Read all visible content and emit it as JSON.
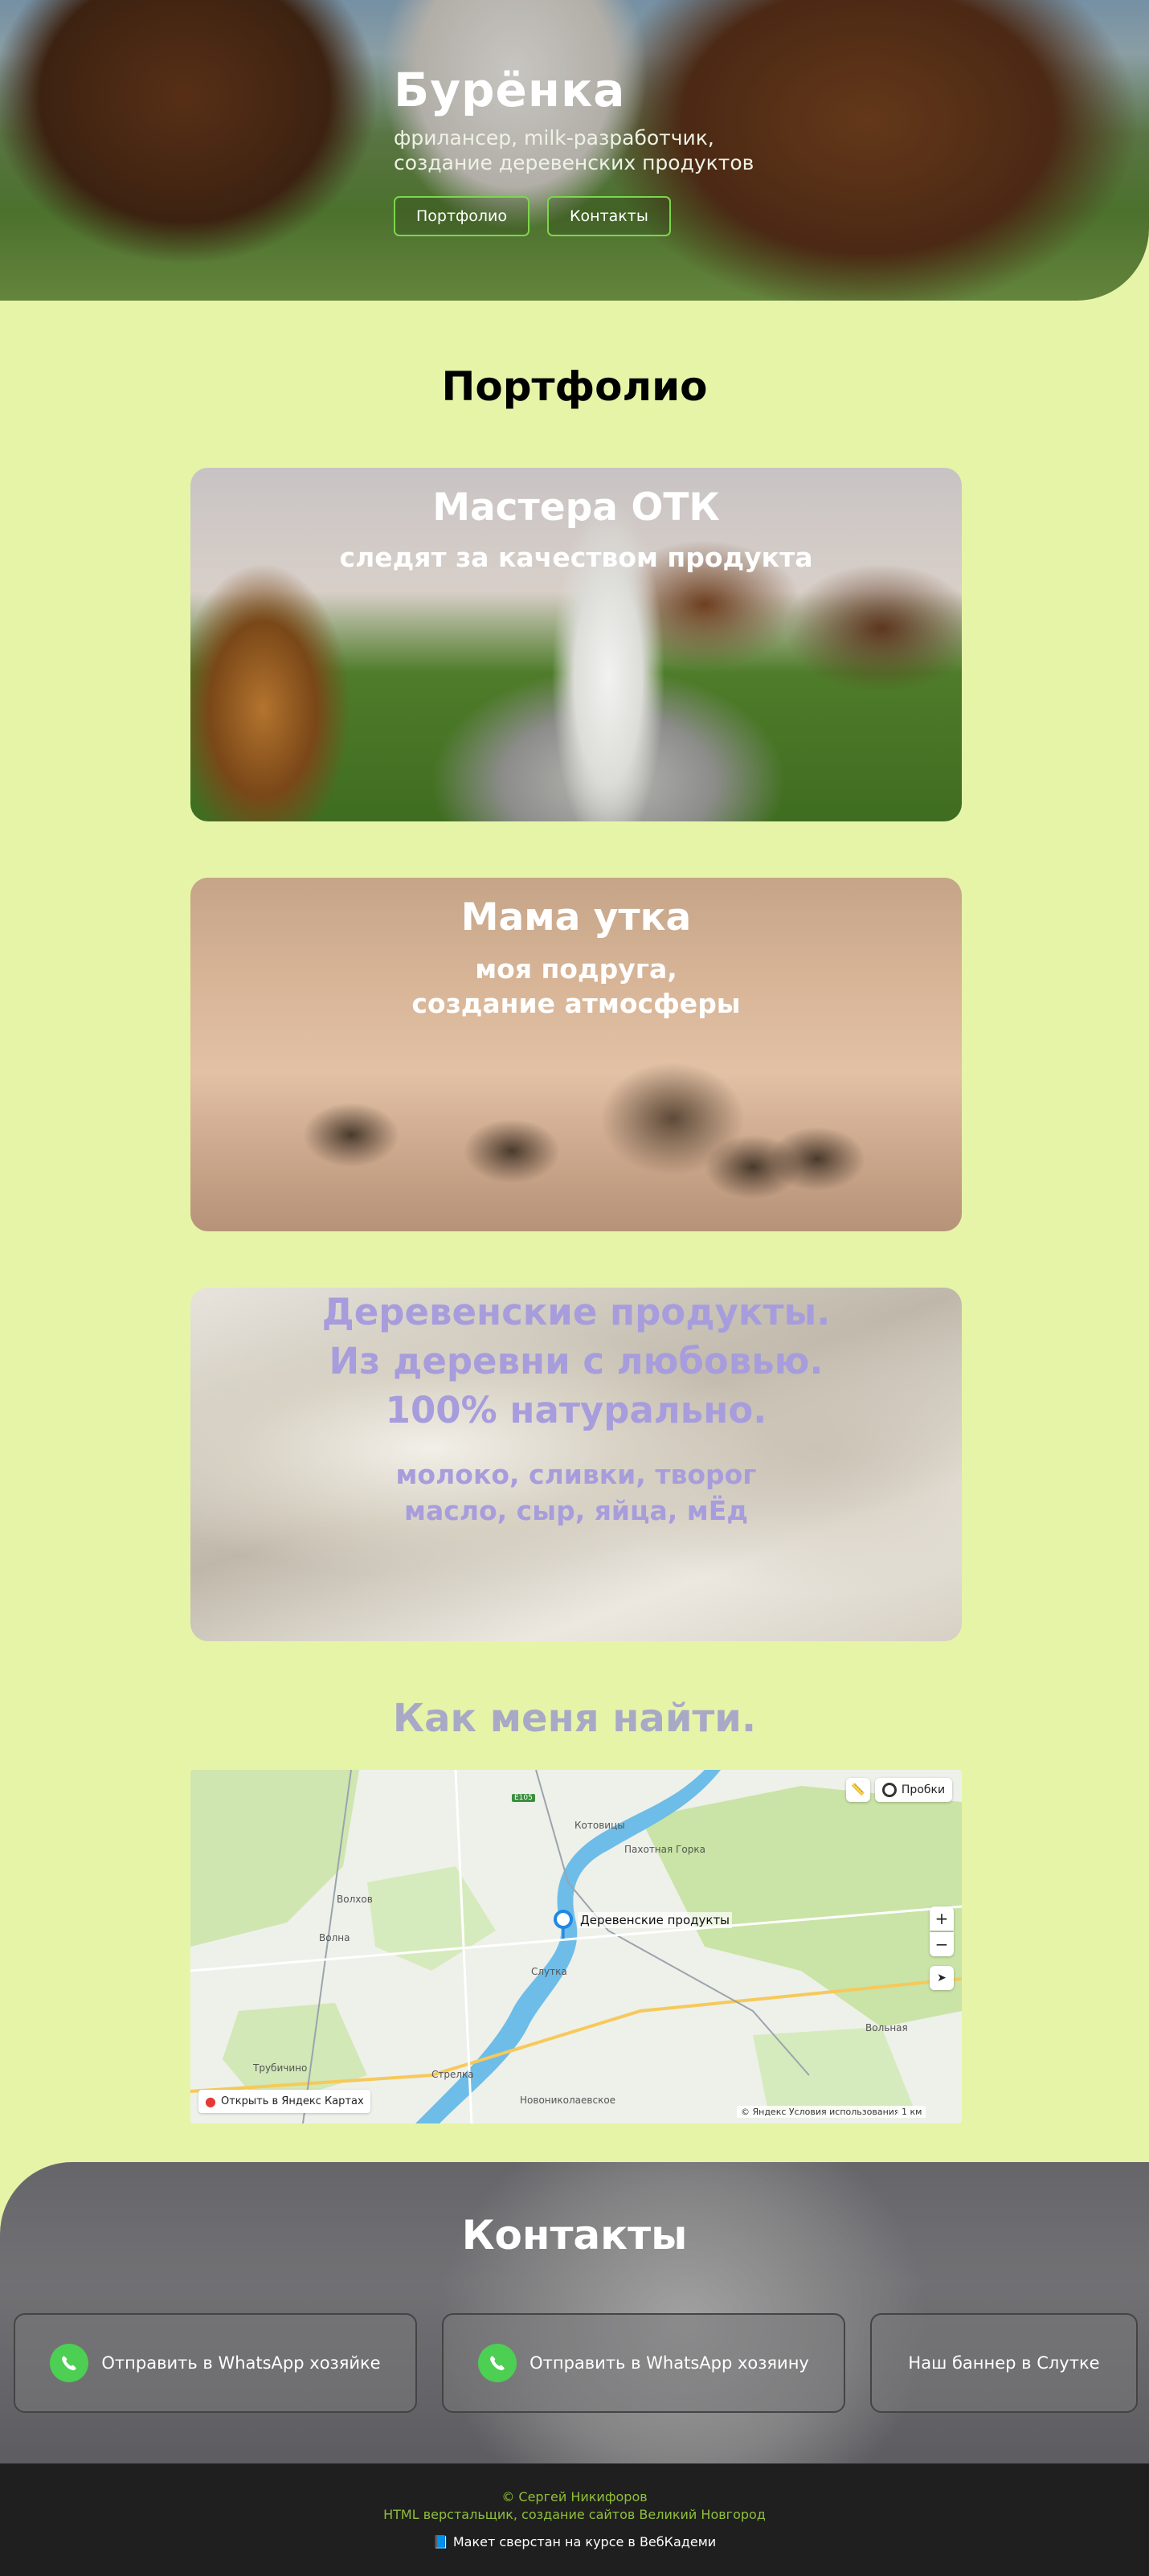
{
  "hero": {
    "title": "Бурёнка",
    "subtitle": "фрилансер, milk-разработчик, создание деревенских продуктов",
    "buttons": [
      "Портфолио",
      "Контакты"
    ]
  },
  "portfolio": {
    "title": "Портфолио",
    "cards": [
      {
        "title": "Мастера ОТК",
        "subtitle": "следят за качеством продукта"
      },
      {
        "title": "Мама утка",
        "subtitle": "моя подруга,\nсоздание атмосферы"
      },
      {
        "title": "Деревенские продукты.\nИз деревни с любовью.\n100% натурально.",
        "subtitle": "молоко, сливки, творог\nмасло, сыр, яйца, мЁд"
      }
    ]
  },
  "find": {
    "title": "Как меня найти.",
    "map": {
      "pin_label": "Деревенские продукты",
      "open_link": "Открыть в Яндекс Картах",
      "copyright": "© Яндекс   Условия использования",
      "scale": "1 км",
      "traffic": "Пробки",
      "zoom_in": "+",
      "zoom_out": "−",
      "places": [
        "Котовицы",
        "Пахотная Горка",
        "Волна",
        "Слутка",
        "Трубичино",
        "Стрелка",
        "Новониколаевское",
        "Вольная",
        "Волхов"
      ],
      "road": "E105"
    }
  },
  "contacts": {
    "title": "Контакты",
    "buttons": [
      "Отправить в WhatsApp хозяйке",
      "Отправить в WhatsApp хозяину",
      "Наш баннер в Слутке"
    ]
  },
  "footer": {
    "line1": "© Сергей Никифоров",
    "line2": "HTML верстальщик, создание сайтов Великий Новгород",
    "line3": "📘 Макет сверстан на курсе в ВебКадеми"
  },
  "colors": {
    "background": "#e6f4a8",
    "accent": "#7cd64c",
    "purple": "#a79ddc",
    "whatsapp": "#4ccf52"
  }
}
